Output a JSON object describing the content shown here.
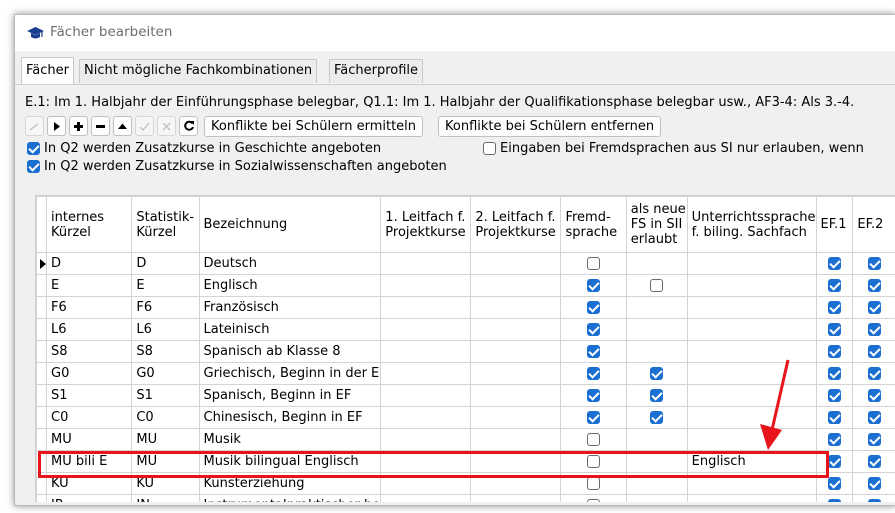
{
  "window": {
    "title": "Fächer bearbeiten",
    "title_icon": "graduation-cap-icon"
  },
  "tabs": [
    {
      "label": "Fächer",
      "active": true
    },
    {
      "label": "Nicht mögliche Fachkombinationen",
      "active": false
    },
    {
      "label": "Fächerprofile",
      "active": false
    }
  ],
  "info_text": "E.1: Im 1. Halbjahr der Einführungsphase belegbar, Q1.1: Im 1. Halbjahr der Qualifikationsphase belegbar usw., AF3-4: Als 3.-4.",
  "toolbar": {
    "icons": [
      "line-icon",
      "next-record-icon",
      "add-icon",
      "remove-icon",
      "move-up-icon",
      "confirm-icon",
      "cancel-icon",
      "refresh-icon"
    ],
    "btn_conflicts_find": "Konflikte bei Schülern ermitteln",
    "btn_conflicts_remove": "Konflikte bei Schülern entfernen"
  },
  "options": {
    "q2_geschichte": {
      "label": "In Q2 werden Zusatzkurse in Geschichte angeboten",
      "checked": true
    },
    "q2_sowi": {
      "label": "In Q2 werden Zusatzkurse in Sozialwissenschaften angeboten",
      "checked": true
    },
    "fremdsprachen_si": {
      "label": "Eingaben bei Fremdsprachen aus SI nur erlauben, wenn",
      "checked": false
    }
  },
  "columns": [
    "internes Kürzel",
    "Statistik-Kürzel",
    "Bezeichnung",
    "1. Leitfach f. Projektkurse",
    "2. Leitfach f. Projektkurse",
    "Fremd-sprache",
    "als neue FS in SII erlaubt",
    "Unterrichtssprache f. biling. Sachfach",
    "EF.1",
    "EF.2"
  ],
  "rows": [
    {
      "kuerzel": "D",
      "statistik": "D",
      "bezeichnung": "Deutsch",
      "fremd": false,
      "neu_fs": null,
      "sprache": "",
      "ef1": true,
      "ef2": true,
      "current": true
    },
    {
      "kuerzel": "E",
      "statistik": "E",
      "bezeichnung": "Englisch",
      "fremd": true,
      "neu_fs": false,
      "sprache": "",
      "ef1": true,
      "ef2": true
    },
    {
      "kuerzel": "F6",
      "statistik": "F6",
      "bezeichnung": "Französisch",
      "fremd": true,
      "neu_fs": null,
      "sprache": "",
      "ef1": true,
      "ef2": true
    },
    {
      "kuerzel": "L6",
      "statistik": "L6",
      "bezeichnung": "Lateinisch",
      "fremd": true,
      "neu_fs": null,
      "sprache": "",
      "ef1": true,
      "ef2": true
    },
    {
      "kuerzel": "S8",
      "statistik": "S8",
      "bezeichnung": "Spanisch ab Klasse 8",
      "fremd": true,
      "neu_fs": null,
      "sprache": "",
      "ef1": true,
      "ef2": true
    },
    {
      "kuerzel": "G0",
      "statistik": "G0",
      "bezeichnung": "Griechisch, Beginn in der E",
      "fremd": true,
      "neu_fs": true,
      "sprache": "",
      "ef1": true,
      "ef2": true
    },
    {
      "kuerzel": "S1",
      "statistik": "S1",
      "bezeichnung": "Spanisch, Beginn in EF",
      "fremd": true,
      "neu_fs": true,
      "sprache": "",
      "ef1": true,
      "ef2": true
    },
    {
      "kuerzel": "C0",
      "statistik": "C0",
      "bezeichnung": "Chinesisch, Beginn in EF",
      "fremd": true,
      "neu_fs": true,
      "sprache": "",
      "ef1": true,
      "ef2": true
    },
    {
      "kuerzel": "MU",
      "statistik": "MU",
      "bezeichnung": "Musik",
      "fremd": false,
      "neu_fs": null,
      "sprache": "",
      "ef1": true,
      "ef2": true
    },
    {
      "kuerzel": "MU bili E",
      "statistik": "MU",
      "bezeichnung": "Musik bilingual Englisch",
      "fremd": false,
      "neu_fs": null,
      "sprache": "Englisch",
      "ef1": true,
      "ef2": true
    },
    {
      "kuerzel": "KU",
      "statistik": "KU",
      "bezeichnung": "Kunsterziehung",
      "fremd": false,
      "neu_fs": null,
      "sprache": "",
      "ef1": true,
      "ef2": true
    },
    {
      "kuerzel": "IP",
      "statistik": "IN",
      "bezeichnung": "Instrumentalpraktischer be",
      "fremd": false,
      "neu_fs": null,
      "sprache": "",
      "ef1": true,
      "ef2": true
    }
  ],
  "annotation": {
    "highlight_color": "#e8141b",
    "checkbox_color": "#1a6fd1"
  }
}
